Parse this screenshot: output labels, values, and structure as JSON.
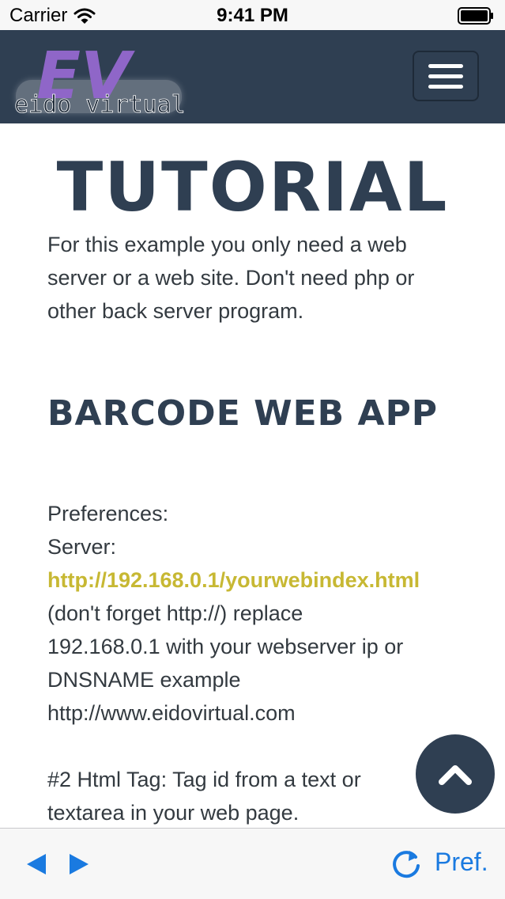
{
  "status_bar": {
    "carrier": "Carrier",
    "time": "9:41 PM"
  },
  "navbar": {
    "logo_text": "EIDO VIRTUAL",
    "logo_mark": "EV"
  },
  "content": {
    "title": "TUTORIAL",
    "intro": "For this example you only need a web server or a web site. Don't need php or other back server program.",
    "section_title": "BARCODE WEB APP",
    "lines": [
      "Preferences:",
      "Server:"
    ],
    "link": "http://192.168.0.1/yourwebindex.html",
    "after_link": [
      "(don't forget http://) replace",
      "192.168.0.1 with your webserver ip or",
      "DNSNAME example",
      "http://www.eidovirtual.com"
    ],
    "html_tag_lines": [
      "#2 Html Tag: Tag id from a text or",
      "textarea in your web page."
    ]
  },
  "toolbar": {
    "pref_label": "Pref."
  },
  "colors": {
    "navbar": "#2f3f52",
    "heading": "#2f3f52",
    "link": "#c7b833",
    "accent": "#1a7ae0"
  }
}
